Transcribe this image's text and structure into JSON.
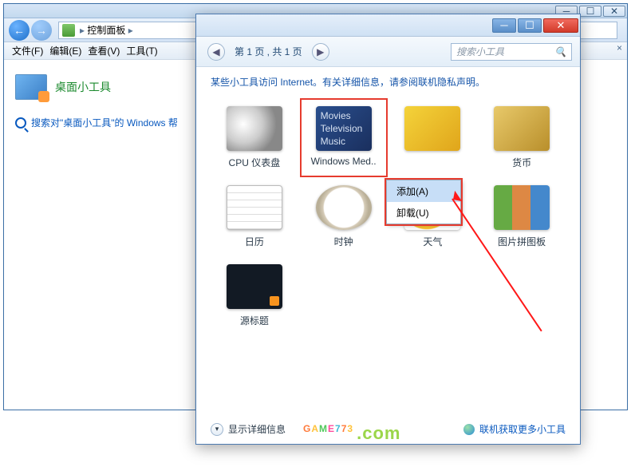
{
  "outer": {
    "breadcrumb": "控制面板",
    "menu": {
      "file": "文件(F)",
      "edit": "编辑(E)",
      "view": "查看(V)",
      "tools": "工具(T)"
    }
  },
  "left": {
    "title": "桌面小工具",
    "search_link": "搜索对\"桌面小工具\"的 Windows 帮"
  },
  "dialog": {
    "page_label": "第 1 页 , 共 1 页",
    "search_placeholder": "搜索小工具",
    "info_prefix": "某些小工具访问 Internet。有关详细信息，请参阅",
    "info_link": "联机隐私声明",
    "info_suffix": "。",
    "details_btn": "显示详细信息",
    "more_link": "联机获取更多小工具"
  },
  "gadgets": [
    {
      "id": "cpu",
      "label": "CPU 仪表盘"
    },
    {
      "id": "wmc",
      "label": "Windows Med..",
      "selected": true,
      "tile_lines": [
        "Movies",
        "Television",
        "Music"
      ]
    },
    {
      "id": "slide",
      "label": ""
    },
    {
      "id": "currency",
      "label": "货币"
    },
    {
      "id": "calendar",
      "label": "日历"
    },
    {
      "id": "clock",
      "label": "时钟"
    },
    {
      "id": "weather",
      "label": "天气"
    },
    {
      "id": "puzzle",
      "label": "图片拼图板"
    },
    {
      "id": "feed",
      "label": "源标题"
    }
  ],
  "context_menu": {
    "add": "添加(A)",
    "uninstall": "卸载(U)"
  },
  "watermark": "GAME773",
  "watermark_domain": ".com"
}
